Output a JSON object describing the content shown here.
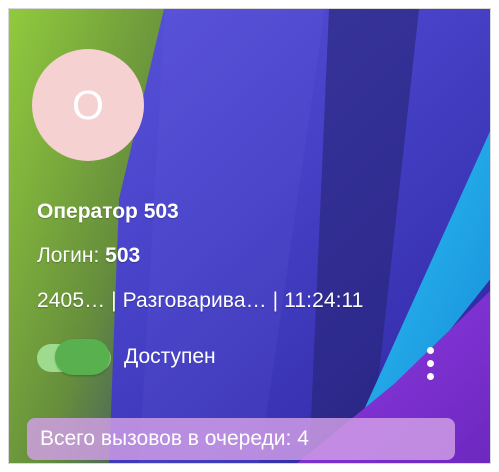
{
  "operator": {
    "avatar_letter": "O",
    "name": "Оператор 503",
    "login_label": "Логин:",
    "login_value": "503",
    "status_line": "2405…  | Разговарива… | 11:24:11",
    "availability_label": "Доступен",
    "queue_text": "Всего вызовов в очереди:  4"
  },
  "icons": {
    "menu": "more-vertical-icon"
  },
  "colors": {
    "avatar_background": "#f6d1d2",
    "toggle_track": "#9edb8f",
    "toggle_knob": "#58b04e",
    "queue_chip": "#d3a0e8"
  },
  "state": {
    "available": true
  }
}
